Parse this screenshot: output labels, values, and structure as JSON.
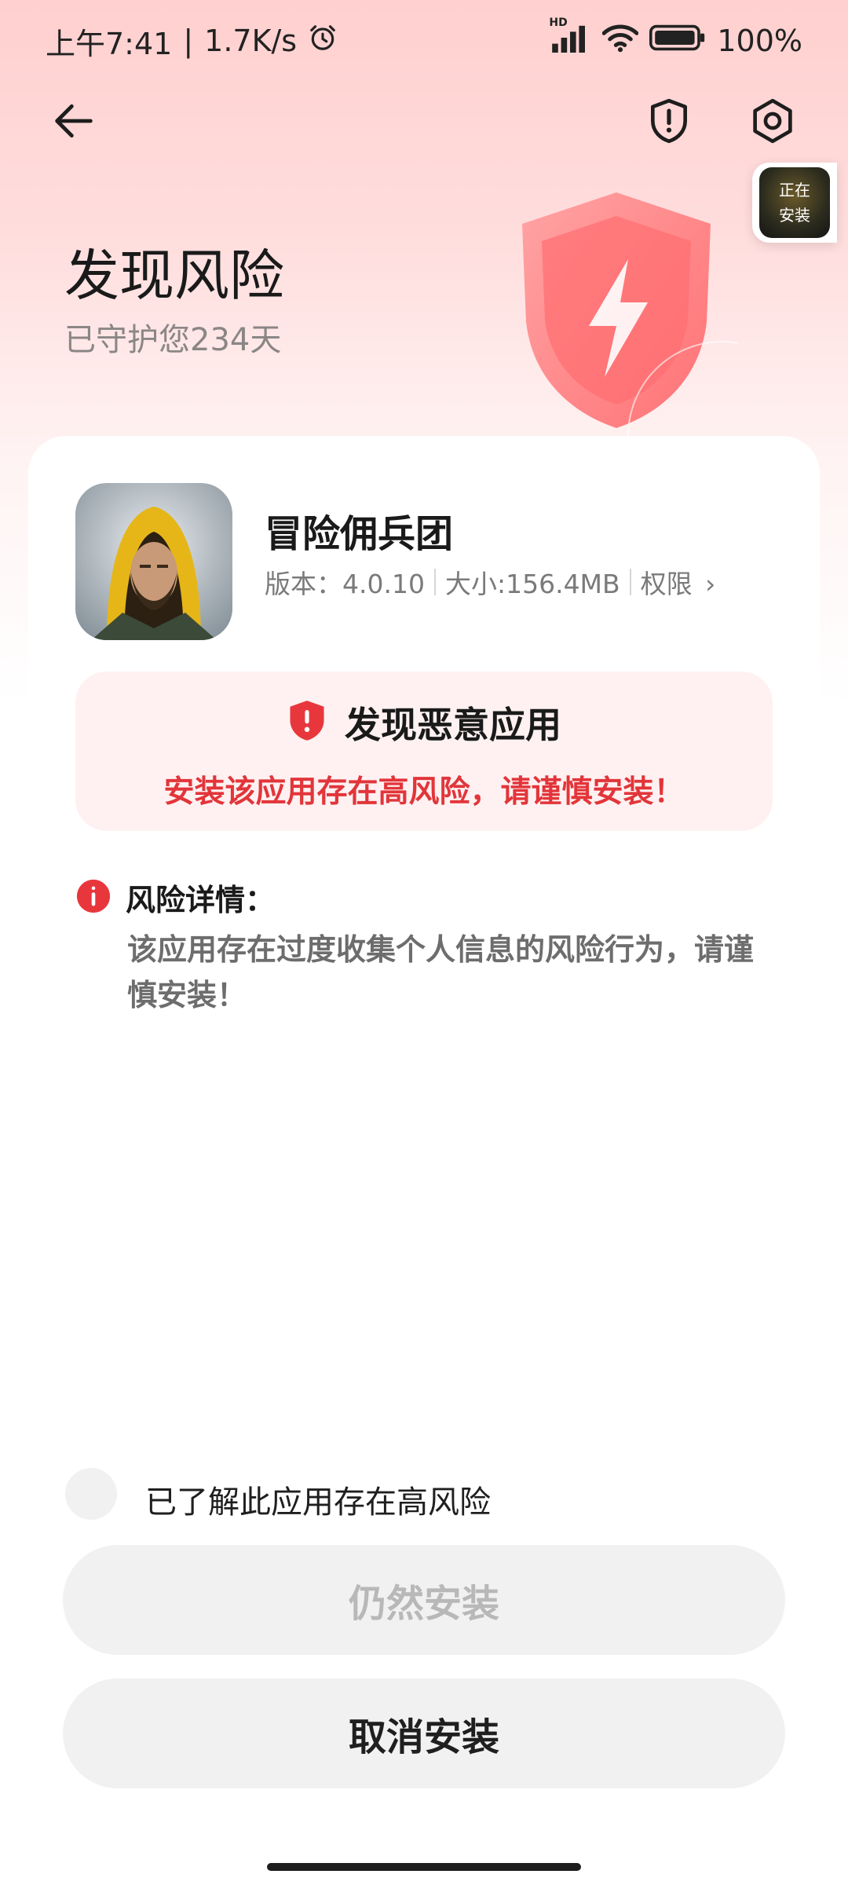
{
  "status_bar": {
    "time": "上午7:41",
    "network_speed": "1.7K/s",
    "battery": "100%",
    "hd_label": "HD"
  },
  "header": {
    "title": "发现风险",
    "subtitle": "已守护您234天",
    "floating_badge_text": [
      "正在",
      "安装"
    ]
  },
  "app": {
    "name": "冒险佣兵团",
    "version": "版本：4.0.10",
    "size": "大小:156.4MB",
    "permissions": "权限",
    "permissions_chevron": "›"
  },
  "alert": {
    "title": "发现恶意应用",
    "description": "安装该应用存在高风险，请谨慎安装！"
  },
  "risk": {
    "label": "风险详情：",
    "text": "该应用存在过度收集个人信息的风险行为，请谨慎安装！"
  },
  "acknowledge": {
    "label": "已了解此应用存在高风险"
  },
  "buttons": {
    "install_anyway": "仍然安装",
    "cancel_install": "取消安装"
  },
  "colors": {
    "accent_red": "#e2353a",
    "alert_bg": "#fff1f1",
    "button_bg": "#f1f1f1"
  },
  "icons": [
    "back-arrow-icon",
    "shield-alert-icon",
    "gear-icon",
    "red-shield-icon",
    "info-icon",
    "alarm-clock-icon",
    "signal-icon",
    "wifi-icon",
    "battery-icon"
  ]
}
